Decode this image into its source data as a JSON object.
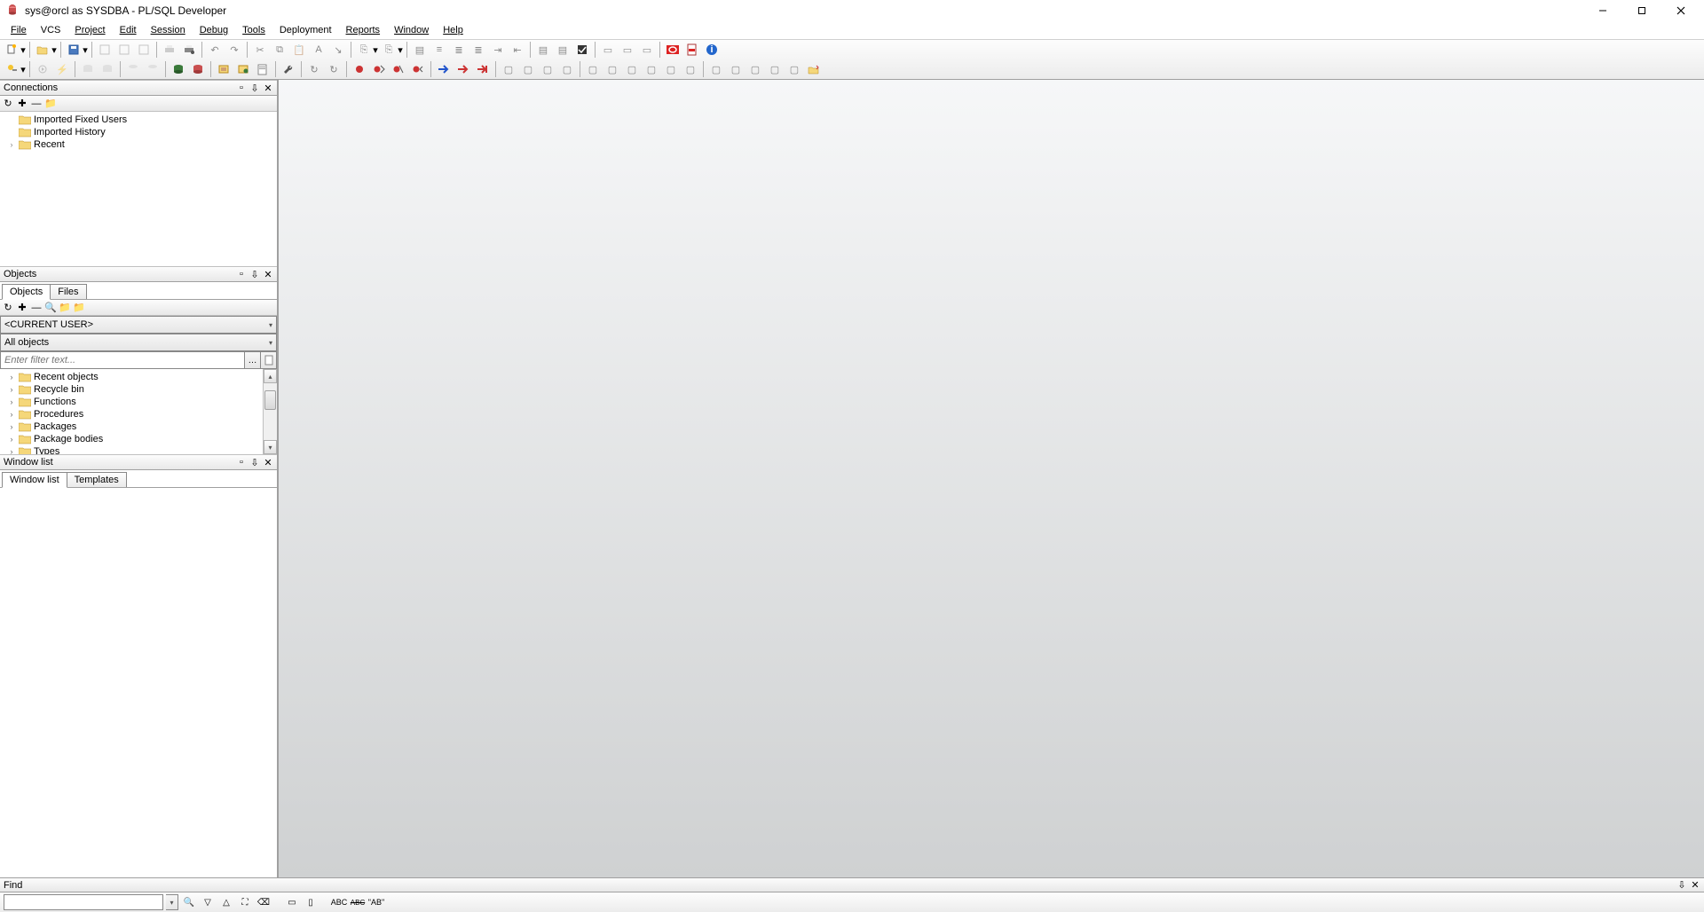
{
  "window": {
    "title": "sys@orcl as SYSDBA - PL/SQL Developer"
  },
  "menu": {
    "items": [
      "File",
      "VCS",
      "Project",
      "Edit",
      "Session",
      "Debug",
      "Tools",
      "Deployment",
      "Reports",
      "Window",
      "Help"
    ]
  },
  "panels": {
    "connections": {
      "title": "Connections",
      "nodes": [
        {
          "label": "Imported Fixed Users",
          "expandable": false
        },
        {
          "label": "Imported History",
          "expandable": false
        },
        {
          "label": "Recent",
          "expandable": true
        }
      ]
    },
    "objects": {
      "title": "Objects",
      "tabs": [
        "Objects",
        "Files"
      ],
      "active_tab": 0,
      "user_dropdown": "<CURRENT USER>",
      "filter_dropdown": "All objects",
      "filter_placeholder": "Enter filter text...",
      "nodes": [
        {
          "label": "Recent objects"
        },
        {
          "label": "Recycle bin"
        },
        {
          "label": "Functions"
        },
        {
          "label": "Procedures"
        },
        {
          "label": "Packages"
        },
        {
          "label": "Package bodies"
        },
        {
          "label": "Types"
        }
      ]
    },
    "windowlist": {
      "title": "Window list",
      "tabs": [
        "Window list",
        "Templates"
      ],
      "active_tab": 0
    },
    "find": {
      "title": "Find"
    }
  }
}
